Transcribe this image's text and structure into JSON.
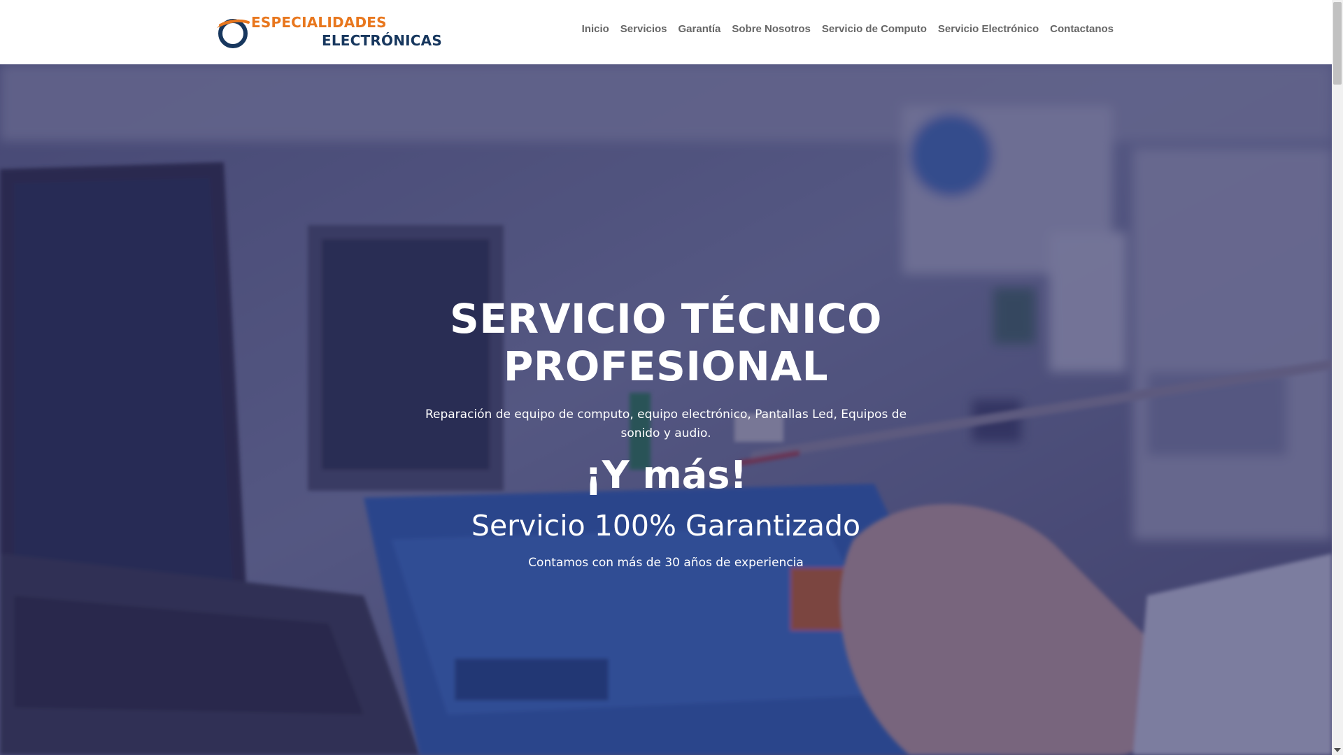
{
  "header": {
    "logo": {
      "line1": "ESPECIALIDADES",
      "line2": "ELECTRÓNICAS"
    },
    "nav": [
      {
        "label": "Inicio"
      },
      {
        "label": "Servicios"
      },
      {
        "label": "Garantía"
      },
      {
        "label": "Sobre Nosotros"
      },
      {
        "label": "Servicio de Computo"
      },
      {
        "label": "Servicio Electrónico"
      },
      {
        "label": "Contactanos"
      }
    ]
  },
  "hero": {
    "title": "SERVICIO TÉCNICO PROFESIONAL",
    "description": "Reparación de equipo de computo, equipo electrónico, Pantallas Led, Equipos de sonido y audio.",
    "highlight": "¡Y más!",
    "guarantee": "Servicio 100% Garantizado",
    "experience": "Contamos con más de 30 años de experiencia",
    "background_image": "electronics-repair-photo"
  },
  "colors": {
    "brand_orange": "#e8771e",
    "brand_navy": "#17375e",
    "nav_text": "#666666",
    "hero_overlay": "#28265f"
  }
}
